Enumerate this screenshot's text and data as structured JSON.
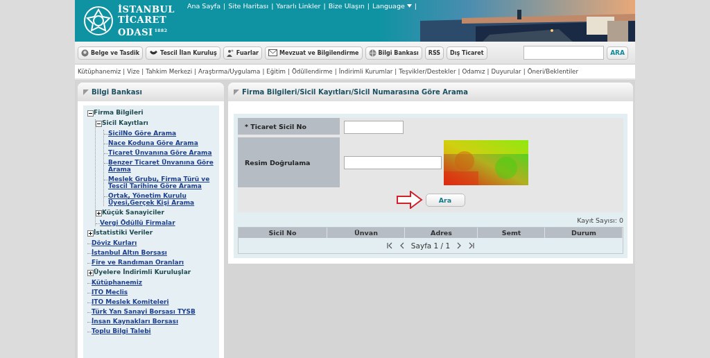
{
  "header": {
    "logo_lines": [
      "İSTANBUL",
      "TİCARET",
      "ODASI"
    ],
    "logo_year": "1882",
    "separator": "|",
    "links": [
      {
        "label": "Ana Sayfa",
        "dropdown": false
      },
      {
        "label": "Site Haritası",
        "dropdown": false
      },
      {
        "label": "Yararlı Linkler",
        "dropdown": false
      },
      {
        "label": "Bize Ulaşın",
        "dropdown": false
      },
      {
        "label": "Language",
        "dropdown": true
      }
    ],
    "trailing_separator": "|"
  },
  "toolbar": {
    "buttons": [
      "Belge ve Tasdik",
      "Tescil İlan Kuruluş",
      "Fuarlar",
      "Mevzuat ve Bilgilendirme",
      "Bilgi Bankası",
      "RSS",
      "Dış Ticaret"
    ],
    "search_button": "ARA"
  },
  "subnav": {
    "separator": "|",
    "links": [
      "Kütüphanemiz",
      "Vize",
      "Tahkim Merkezi",
      "Araştırma/Uygulama",
      "Eğitim",
      "Ödüllendirme",
      "İndirimli Kurumlar",
      "Teşvikler/Destekler",
      "Odamız",
      "Duyurular",
      "Öneri/Beklentiler"
    ]
  },
  "sidebar": {
    "title": "Bilgi Bankası",
    "tree": [
      {
        "kind": "folder",
        "label": "Firma Bilgileri",
        "expanded": true,
        "children": [
          {
            "kind": "folder",
            "label": "Sicil Kayıtları",
            "expanded": true,
            "children": [
              {
                "kind": "link",
                "label": "SicilNo Göre Arama"
              },
              {
                "kind": "link",
                "label": "Nace Koduna Göre Arama"
              },
              {
                "kind": "link",
                "label": "Ticaret Ünvanına Göre Arama"
              },
              {
                "kind": "link",
                "label": "Benzer Ticaret Ünvanına Göre Arama"
              },
              {
                "kind": "link",
                "label": "Meslek Grubu, Firma Türü ve Tescil Tarihine Göre Arama"
              },
              {
                "kind": "link",
                "label": "Ortak, Yönetim Kurulu Üyesi,Gerçek Kişi Arama"
              }
            ]
          },
          {
            "kind": "folder",
            "label": "Küçük Sanayiciler",
            "expanded": false
          },
          {
            "kind": "link",
            "label": "Vergi Ödüllü Firmalar"
          }
        ]
      },
      {
        "kind": "folder",
        "label": "İstatistiki Veriler",
        "expanded": false
      },
      {
        "kind": "link",
        "label": "Döviz Kurları"
      },
      {
        "kind": "link",
        "label": "İstanbul Altın Borsası"
      },
      {
        "kind": "link",
        "label": "Fire ve Randıman Oranları"
      },
      {
        "kind": "folder",
        "label": "Üyelere İndirimli Kuruluşlar",
        "expanded": false
      },
      {
        "kind": "link",
        "label": "Kütüphanemiz"
      },
      {
        "kind": "link",
        "label": "ITO Meclis"
      },
      {
        "kind": "link",
        "label": "ITO Meslek Komiteleri"
      },
      {
        "kind": "link",
        "label": "Türk Yan Sanayi Borsası TYSB"
      },
      {
        "kind": "link",
        "label": "İnsan Kaynakları Borsası"
      },
      {
        "kind": "link",
        "label": "Toplu Bilgi Talebi"
      }
    ]
  },
  "main": {
    "title": "Firma Bilgileri/Sicil Kayıtları/Sicil Numarasına Göre Arama",
    "form": {
      "fields": [
        {
          "label": "* Ticaret Sicil No",
          "kind": "input"
        },
        {
          "label": "Resim Doğrulama",
          "kind": "captcha"
        }
      ],
      "submit": "Ara"
    },
    "record_count": "Kayıt Sayısı: 0",
    "table": {
      "columns": [
        "Sicil No",
        "Ünvan",
        "Adres",
        "Semt",
        "Durum"
      ]
    },
    "pager": "Sayfa 1 / 1"
  }
}
